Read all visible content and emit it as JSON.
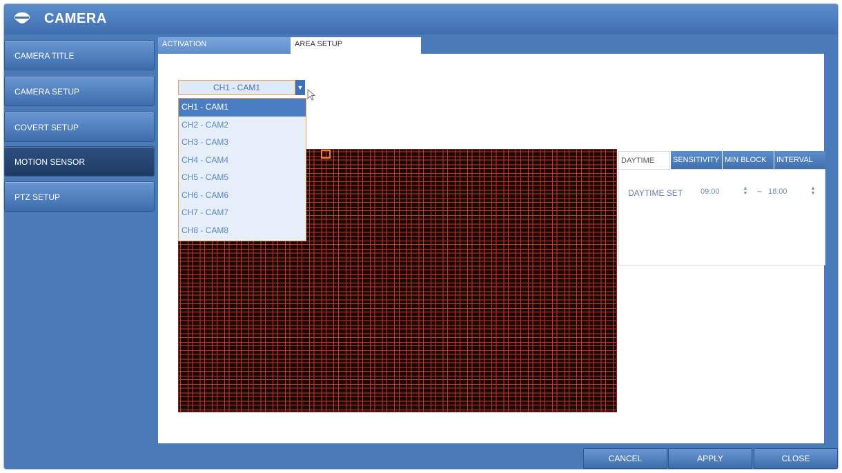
{
  "window": {
    "title": "CAMERA"
  },
  "sidebar": {
    "items": [
      {
        "label": "CAMERA TITLE"
      },
      {
        "label": "CAMERA SETUP"
      },
      {
        "label": "COVERT SETUP"
      },
      {
        "label": "MOTION SENSOR",
        "active": true
      },
      {
        "label": "PTZ SETUP"
      }
    ]
  },
  "tabs": [
    {
      "label": "ACTIVATION"
    },
    {
      "label": "AREA SETUP",
      "active": true
    }
  ],
  "channel_select": {
    "value": "CH1 - CAM1",
    "options": [
      "CH1 - CAM1",
      "CH2 - CAM2",
      "CH3 - CAM3",
      "CH4 - CAM4",
      "CH5 - CAM5",
      "CH6 - CAM6",
      "CH7 - CAM7",
      "CH8 - CAM8"
    ],
    "selected_index": 0
  },
  "settings_tabs": [
    {
      "label": "DAYTIME",
      "active": true
    },
    {
      "label": "SENSITIVITY"
    },
    {
      "label": "MIN BLOCK"
    },
    {
      "label": "INTERVAL"
    }
  ],
  "daytime": {
    "label": "DAYTIME SET",
    "start": "09:00",
    "separator": "~",
    "end": "18:00"
  },
  "footer": {
    "cancel": "CANCEL",
    "apply": "APPLY",
    "close": "CLOSE"
  },
  "colors": {
    "accent": "#4a7bb8",
    "grid_line": "#c0392b",
    "grid_bg": "#1d0906",
    "highlight": "#f08030"
  }
}
